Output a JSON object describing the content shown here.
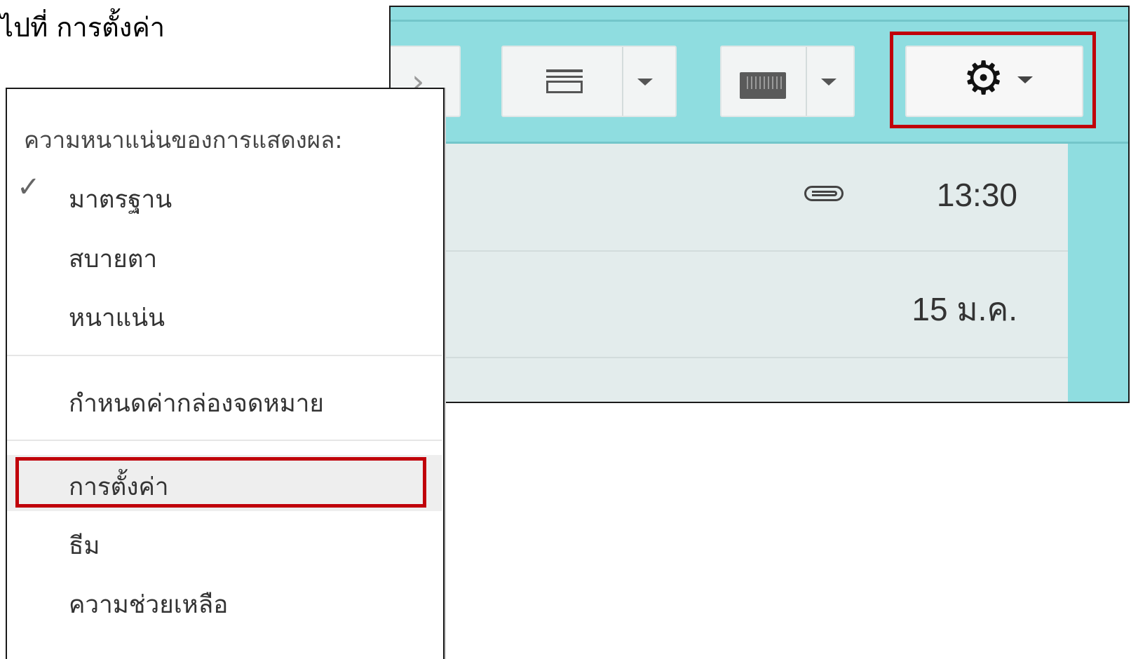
{
  "caption": "ไปที่ การตั้งค่า",
  "toolbar": {
    "back_icon": "chevron-right-icon",
    "density_icon": "display-density-icon",
    "keyboard_icon": "keyboard-icon",
    "settings_icon": "gear-icon",
    "highlight_color": "#c0000a",
    "background_color": "#8fdde0"
  },
  "mail_list": {
    "rows": [
      {
        "time": "13:30",
        "has_attachment": true
      },
      {
        "time": "15 ม.ค.",
        "has_attachment": false
      }
    ]
  },
  "menu": {
    "heading": "ความหนาแน่นของการแสดงผล:",
    "density_options": [
      {
        "label": "มาตรฐาน",
        "checked": true
      },
      {
        "label": "สบายตา",
        "checked": false
      },
      {
        "label": "หนาแน่น",
        "checked": false
      }
    ],
    "configure_inbox": "กำหนดค่ากล่องจดหมาย",
    "settings": "การตั้งค่า",
    "themes": "ธีม",
    "help": "ความช่วยเหลือ"
  }
}
